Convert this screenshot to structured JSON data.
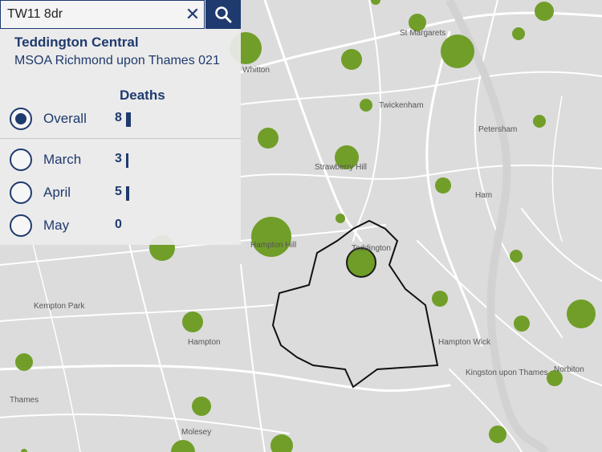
{
  "search": {
    "query": "TW11 8dr",
    "clear_icon": "close-icon",
    "search_icon": "search-icon"
  },
  "area": {
    "name": "Teddington Central",
    "code": "MSOA Richmond upon Thames 021"
  },
  "table": {
    "header": "Deaths",
    "rows": [
      {
        "label": "Overall",
        "value": "8",
        "selected": true,
        "bar_fraction": 1.0
      },
      {
        "label": "March",
        "value": "3",
        "selected": false,
        "bar_fraction": 0.375
      },
      {
        "label": "April",
        "value": "5",
        "selected": false,
        "bar_fraction": 0.625
      },
      {
        "label": "May",
        "value": "0",
        "selected": false,
        "bar_fraction": 0
      }
    ]
  },
  "places": [
    "Whitton",
    "St Margarets",
    "Twickenham",
    "Petersham",
    "Strawberry Hill",
    "Ham",
    "Hampton Hill",
    "Teddington",
    "Kempton Park",
    "Hampton",
    "Hampton Wick",
    "Kingston upon Thames",
    "Norbiton",
    "Thames",
    "Molesey"
  ],
  "colors": {
    "marker": "#6a9a1f",
    "accent": "#1f3a6e",
    "boundary": "#111111"
  }
}
